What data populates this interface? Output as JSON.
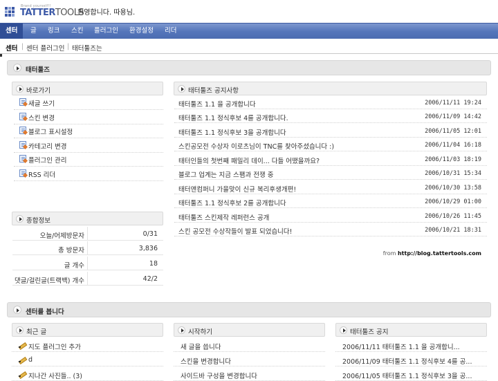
{
  "header": {
    "logo_tagline": "Brand yourself!!",
    "logo_text_1": "TATTER",
    "logo_text_2": "TOOLS",
    "welcome": "환영합니다. 따용님."
  },
  "nav": {
    "items": [
      "센터",
      "글",
      "링크",
      "스킨",
      "플러그인",
      "환경설정",
      "리더"
    ],
    "active": "센터"
  },
  "subnav": {
    "items": [
      "센터",
      "센터 플러그인",
      "태터툴즈는"
    ],
    "current": "센터"
  },
  "section1": {
    "title": "태터툴즈"
  },
  "quick": {
    "title": "바로가기",
    "links": [
      "새글 쓰기",
      "스킨 변경",
      "블로그 표시설정",
      "카테고리 변경",
      "플러그인 관리",
      "RSS 리더"
    ]
  },
  "info": {
    "title": "종합정보",
    "rows": [
      {
        "k": "오늘/어제방문자",
        "v": "0/31"
      },
      {
        "k": "총 방문자",
        "v": "3,836"
      },
      {
        "k": "글 개수",
        "v": "18"
      },
      {
        "k": "댓글/걸린글(트랙백) 개수",
        "v": "42/2"
      }
    ]
  },
  "notices": {
    "title": "태터툴즈 공지사항",
    "items": [
      {
        "title": "태터툴즈 1.1 을 공개합니다",
        "date": "2006/11/11 19:24"
      },
      {
        "title": "태터툴즈 1.1 정식후보 4를 공개합니다.",
        "date": "2006/11/09 14:42"
      },
      {
        "title": "태터툴즈 1.1 정식후보 3을 공개합니다",
        "date": "2006/11/05 12:01"
      },
      {
        "title": "스킨공모전 수상자 이로츠님이 TNC를 찾아주셨습니다 :)",
        "date": "2006/11/04 16:18"
      },
      {
        "title": "태터인들의 첫번째 패밀리 데이... 다들 어땠을까요?",
        "date": "2006/11/03 18:19"
      },
      {
        "title": "블로그 업계는 지금 스팸과 전쟁 중",
        "date": "2006/10/31 15:34"
      },
      {
        "title": "태터앤컴퍼니 가을맞이 신규 복리후생개편!",
        "date": "2006/10/30 13:58"
      },
      {
        "title": "태터툴즈 1.1 정식후보 2를 공개합니다",
        "date": "2006/10/29 01:00"
      },
      {
        "title": "태터툴즈 스킨제작 레퍼런스 공개",
        "date": "2006/10/26 11:45"
      },
      {
        "title": "스킨 공모전 수상작들이 발표 되었습니다!",
        "date": "2006/10/21 18:31"
      }
    ],
    "from_label": "from",
    "from_url": "http://blog.tattertools.com"
  },
  "section2": {
    "title": "센터를 봅니다"
  },
  "recent": {
    "title": "최근 글",
    "items": [
      "지도 플러그인 추가",
      "d",
      "지나간 사진들.. (3)"
    ]
  },
  "start": {
    "title": "시작하기",
    "items": [
      "새 글을 씁니다",
      "스킨을 변경합니다",
      "사이드바 구성을 변경합니다"
    ]
  },
  "tt_notice": {
    "title": "태터툴즈 공지",
    "items": [
      "2006/11/11 태터툴즈 1.1 을 공개합니...",
      "2006/11/09 태터툴즈 1.1 정식후보 4를 공...",
      "2006/11/05 태터툴즈 1.1 정식후보 3을 공..."
    ]
  }
}
